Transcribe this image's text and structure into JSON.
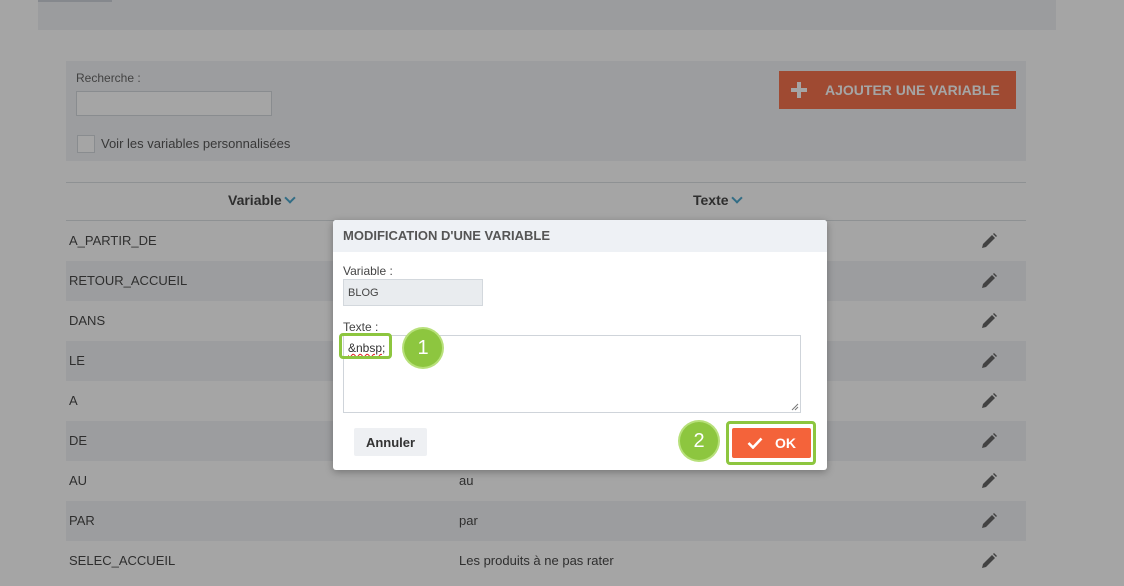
{
  "filters": {
    "search_label": "Recherche :",
    "search_value": "",
    "custom_vars_label": "Voir les variables personnalisées"
  },
  "add_button": {
    "label": "AJOUTER UNE VARIABLE",
    "icon": "plus-icon"
  },
  "table": {
    "headers": {
      "variable": "Variable",
      "texte": "Texte"
    },
    "rows": [
      {
        "variable": "A_PARTIR_DE",
        "texte": ""
      },
      {
        "variable": "RETOUR_ACCUEIL",
        "texte": ""
      },
      {
        "variable": "DANS",
        "texte": ""
      },
      {
        "variable": "LE",
        "texte": ""
      },
      {
        "variable": "A",
        "texte": ""
      },
      {
        "variable": "DE",
        "texte": ""
      },
      {
        "variable": "AU",
        "texte": "au"
      },
      {
        "variable": "PAR",
        "texte": "par"
      },
      {
        "variable": "SELEC_ACCUEIL",
        "texte": "Les produits à ne pas rater"
      }
    ]
  },
  "modal": {
    "title": "MODIFICATION D'UNE VARIABLE",
    "variable_label": "Variable :",
    "variable_value": "BLOG",
    "texte_label": "Texte :",
    "texte_value": "&nbsp;",
    "cancel_label": "Annuler",
    "ok_label": "OK",
    "badge_1": "1",
    "badge_2": "2"
  },
  "colors": {
    "accent": "#f4633a",
    "highlight": "#8dc63f",
    "sort_chevron": "#3a9fc9"
  }
}
